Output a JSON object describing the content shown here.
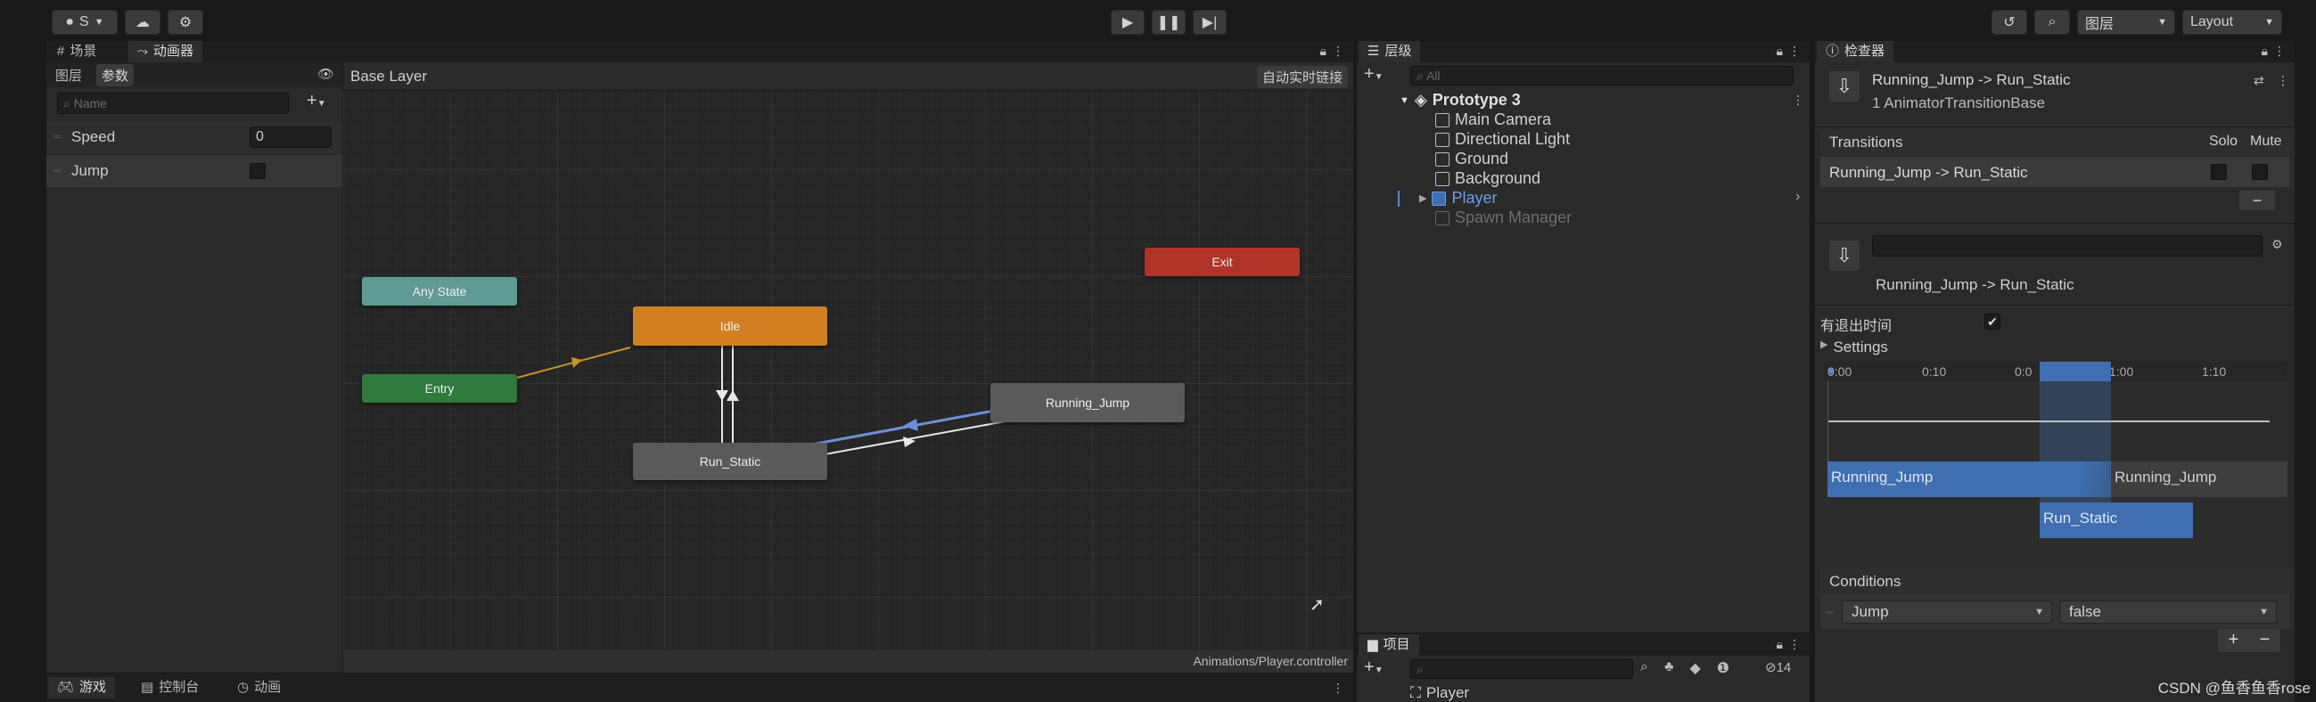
{
  "toolbar": {
    "account_label": "S",
    "right_dropdown_layers": "图层",
    "right_dropdown_layout": "Layout"
  },
  "left_top_tabs": {
    "scene": "场景",
    "animator": "动画器"
  },
  "params_panel": {
    "tab_layers": "图层",
    "tab_params": "参数",
    "search_placeholder": "Name",
    "params": [
      {
        "name": "Speed",
        "value": "0"
      },
      {
        "name": "Jump",
        "value": ""
      }
    ]
  },
  "graph": {
    "breadcrumb": "Base Layer",
    "live_link": "自动实时链接",
    "footer_path": "Animations/Player.controller",
    "nodes": {
      "any_state": "Any State",
      "entry": "Entry",
      "exit": "Exit",
      "idle": "Idle",
      "run_static": "Run_Static",
      "running_jump": "Running_Jump"
    }
  },
  "hierarchy": {
    "tab": "层级",
    "search_placeholder": "All",
    "scene_name": "Prototype 3",
    "items": [
      "Main Camera",
      "Directional Light",
      "Ground",
      "Background",
      "Player",
      "Spawn Manager"
    ]
  },
  "project": {
    "tab": "项目",
    "visible_count": "14",
    "first_item": "Player"
  },
  "bottom_tabs": {
    "game": "游戏",
    "console": "控制台",
    "animation": "动画"
  },
  "inspector": {
    "tab": "检查器",
    "title": "Running_Jump -> Run_Static",
    "subtitle": "1 AnimatorTransitionBase",
    "transitions_header": "Transitions",
    "solo": "Solo",
    "mute": "Mute",
    "transition_item": "Running_Jump -> Run_Static",
    "transition_name": "Running_Jump -> Run_Static",
    "has_exit_time": "有退出时间",
    "settings": "Settings",
    "timeline_ticks": [
      "0:00",
      "0:10",
      "0:0",
      "1:00",
      "1:10"
    ],
    "timeline_bar_a": "Running_Jump",
    "timeline_bar_a2": "Running_Jump",
    "timeline_bar_b": "Run_Static",
    "conditions": "Conditions",
    "condition_param": "Jump",
    "condition_value": "false"
  },
  "watermark": "CSDN @鱼香鱼香rose",
  "colors": {
    "any_state": "#5f9a95",
    "entry": "#2f7a3c",
    "exit": "#b0332a",
    "idle": "#d17f21",
    "state": "#5a5a5a",
    "selected_transition": "#6b8fd6",
    "timeline_blue": "#3f6fb0"
  }
}
